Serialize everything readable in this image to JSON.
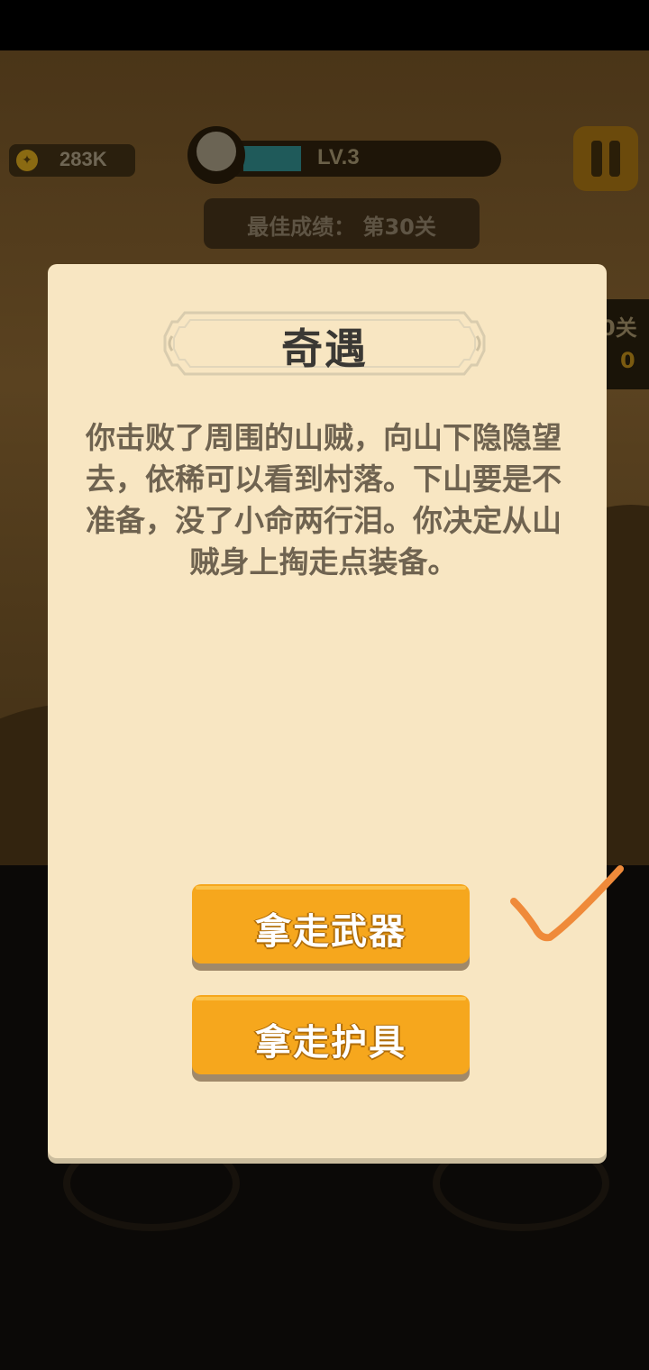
{
  "hud": {
    "coins": "283K",
    "level": "LV.3",
    "level_progress": 0.25,
    "best_score": "最佳成绩： 第30关",
    "side_label": "0关",
    "side_value": "0"
  },
  "modal": {
    "title": "奇遇",
    "story": "你击败了周围的山贼，向山下隐隐望去，依稀可以看到村落。下山要是不准备，没了小命两行泪。你决定从山贼身上掏走点装备。",
    "choices": [
      {
        "label": "拿走武器",
        "selected": true
      },
      {
        "label": "拿走护具",
        "selected": false
      }
    ]
  },
  "colors": {
    "modal_bg": "#f8e6c2",
    "button": "#f6a71d",
    "check_mark": "#ef8a3a"
  },
  "icons": {
    "coin": "coin-icon",
    "pause": "pause-icon",
    "avatar": "avatar-icon",
    "check": "check-icon"
  }
}
